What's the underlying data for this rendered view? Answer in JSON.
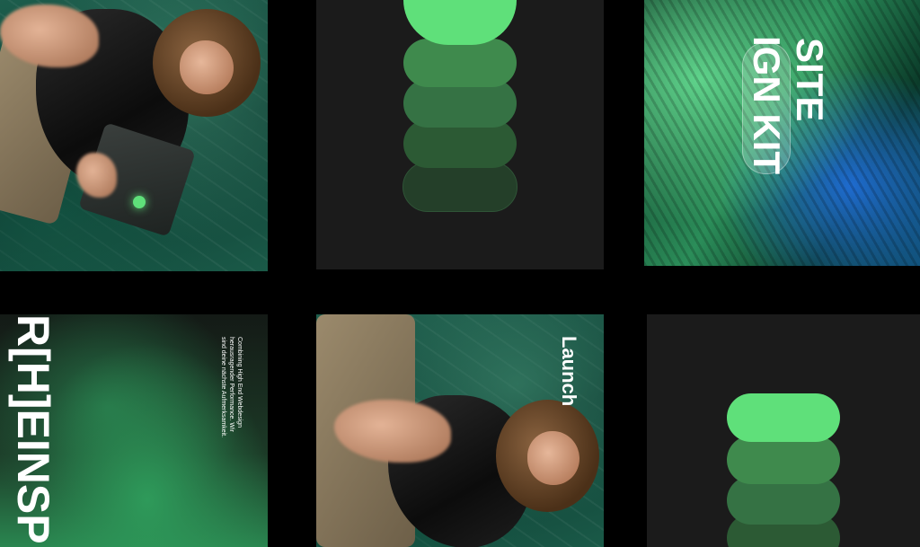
{
  "tiles": {
    "kit": {
      "headline_line1": "SITE",
      "headline_line2": "IGN KIT"
    },
    "inspiration": {
      "headline": "R[H]EINSP",
      "copy_line1": "Combining High End Webdesign",
      "copy_line2": "herausragender Performance. Wir",
      "copy_line3": "sind deine nächste Aufmerksamkeit."
    },
    "launch": {
      "label": "Launch"
    }
  },
  "colors": {
    "accent": "#5fe07a",
    "pill_mid": "#3f8a4d",
    "pill_dark": "#2c5a34",
    "pill_darker": "#243f29",
    "tile_dark": "#1b1b1b"
  }
}
